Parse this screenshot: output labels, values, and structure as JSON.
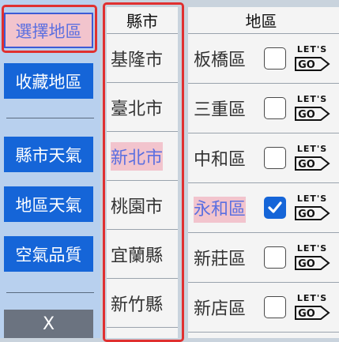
{
  "sidebar": {
    "select_region": "選擇地區",
    "favorites": "收藏地區",
    "city_weather": "縣市天氣",
    "region_weather": "地區天氣",
    "air_quality": "空氣品質",
    "close": "X"
  },
  "city_column": {
    "header": "縣市",
    "items": [
      {
        "label": "基隆市",
        "selected": false
      },
      {
        "label": "臺北市",
        "selected": false
      },
      {
        "label": "新北市",
        "selected": true
      },
      {
        "label": "桃園市",
        "selected": false
      },
      {
        "label": "宜蘭縣",
        "selected": false
      },
      {
        "label": "新竹縣",
        "selected": false
      }
    ]
  },
  "district_column": {
    "header": "地區",
    "go_label": "LET'S GO",
    "go_text_top": "LET'S",
    "go_text_bottom": "GO",
    "items": [
      {
        "label": "板橋區",
        "checked": false
      },
      {
        "label": "三重區",
        "checked": false
      },
      {
        "label": "中和區",
        "checked": false
      },
      {
        "label": "永和區",
        "checked": true
      },
      {
        "label": "新莊區",
        "checked": false
      },
      {
        "label": "新店區",
        "checked": false
      }
    ]
  },
  "colors": {
    "primary": "#1565d8",
    "highlight_bg": "#f2c4cd",
    "highlight_text": "#5b6fe0",
    "outline": "#e03030"
  }
}
